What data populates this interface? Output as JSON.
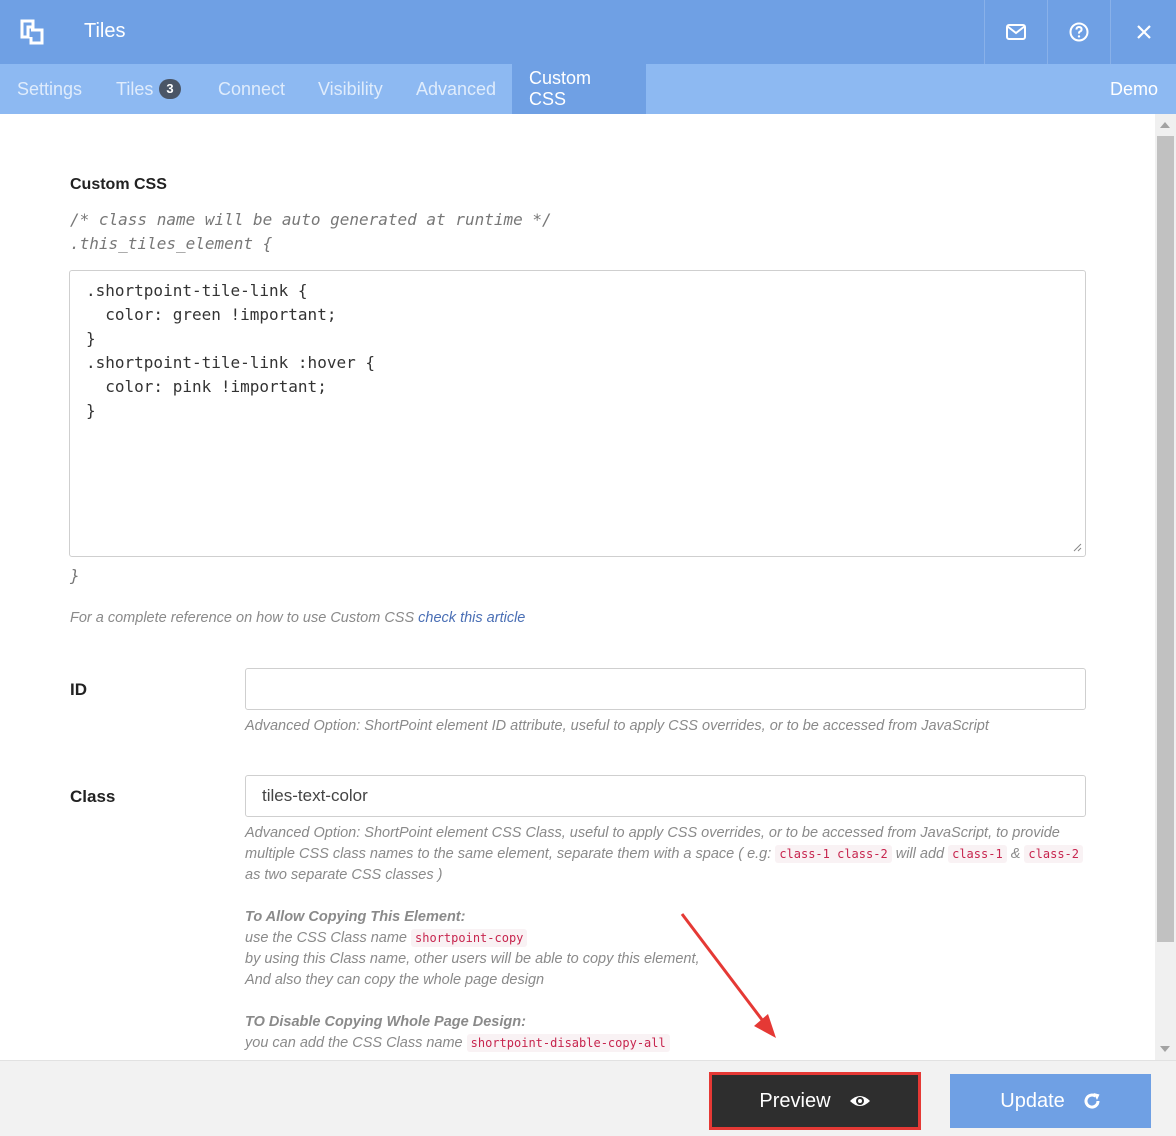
{
  "titlebar": {
    "title": "Tiles",
    "icons": [
      "shortpoint-logo-icon",
      "mail-icon",
      "help-icon",
      "close-icon"
    ]
  },
  "tabs": [
    {
      "label": "Settings"
    },
    {
      "label": "Tiles",
      "badge": "3"
    },
    {
      "label": "Connect"
    },
    {
      "label": "Visibility"
    },
    {
      "label": "Advanced"
    },
    {
      "label": "Custom CSS",
      "active": true
    }
  ],
  "demo_label": "Demo",
  "custom_css": {
    "title": "Custom CSS",
    "comment_line1": "/* class name will be auto generated at runtime */",
    "comment_line2": ".this_tiles_element {",
    "value": ".shortpoint-tile-link {\n  color: green !important;\n}\n.shortpoint-tile-link :hover {\n  color: pink !important;\n}",
    "closing_brace": "}",
    "reference_text": "For a complete reference on how to use Custom CSS ",
    "reference_link": "check this article"
  },
  "id_field": {
    "label": "ID",
    "value": "",
    "help": "Advanced Option: ShortPoint element ID attribute, useful to apply CSS overrides, or to be accessed from JavaScript"
  },
  "class_field": {
    "label": "Class",
    "value": "tiles-text-color",
    "help_part1": "Advanced Option: ShortPoint element CSS Class, useful to apply CSS overrides, or to be accessed from JavaScript, to provide multiple CSS class names to the same element, separate them with a space ( e.g: ",
    "help_code1": "class-1 class-2",
    "help_part2": " will add ",
    "help_code2": "class-1",
    "help_part3": " & ",
    "help_code3": "class-2",
    "help_part4": " as two separate CSS classes )",
    "copy_heading": "To Allow Copying This Element:",
    "copy_line1": "use the CSS Class name ",
    "copy_code": "shortpoint-copy",
    "copy_line2": "by using this Class name, other users will be able to copy this element,",
    "copy_line3": "And also they can copy the whole page design",
    "disable_heading": "TO Disable Copying Whole Page Design:",
    "disable_line1": "you can add the CSS Class name ",
    "disable_code": "shortpoint-disable-copy-all"
  },
  "footer": {
    "preview_label": "Preview",
    "update_label": "Update",
    "preview_icon": "eye-icon",
    "update_icon": "refresh-icon"
  },
  "colors": {
    "titlebar": "#6fa0e4",
    "tabbar": "#8db9f2",
    "preview_button": "#2e2e2e",
    "highlight": "#e53935",
    "update_button": "#6fa0e4"
  }
}
